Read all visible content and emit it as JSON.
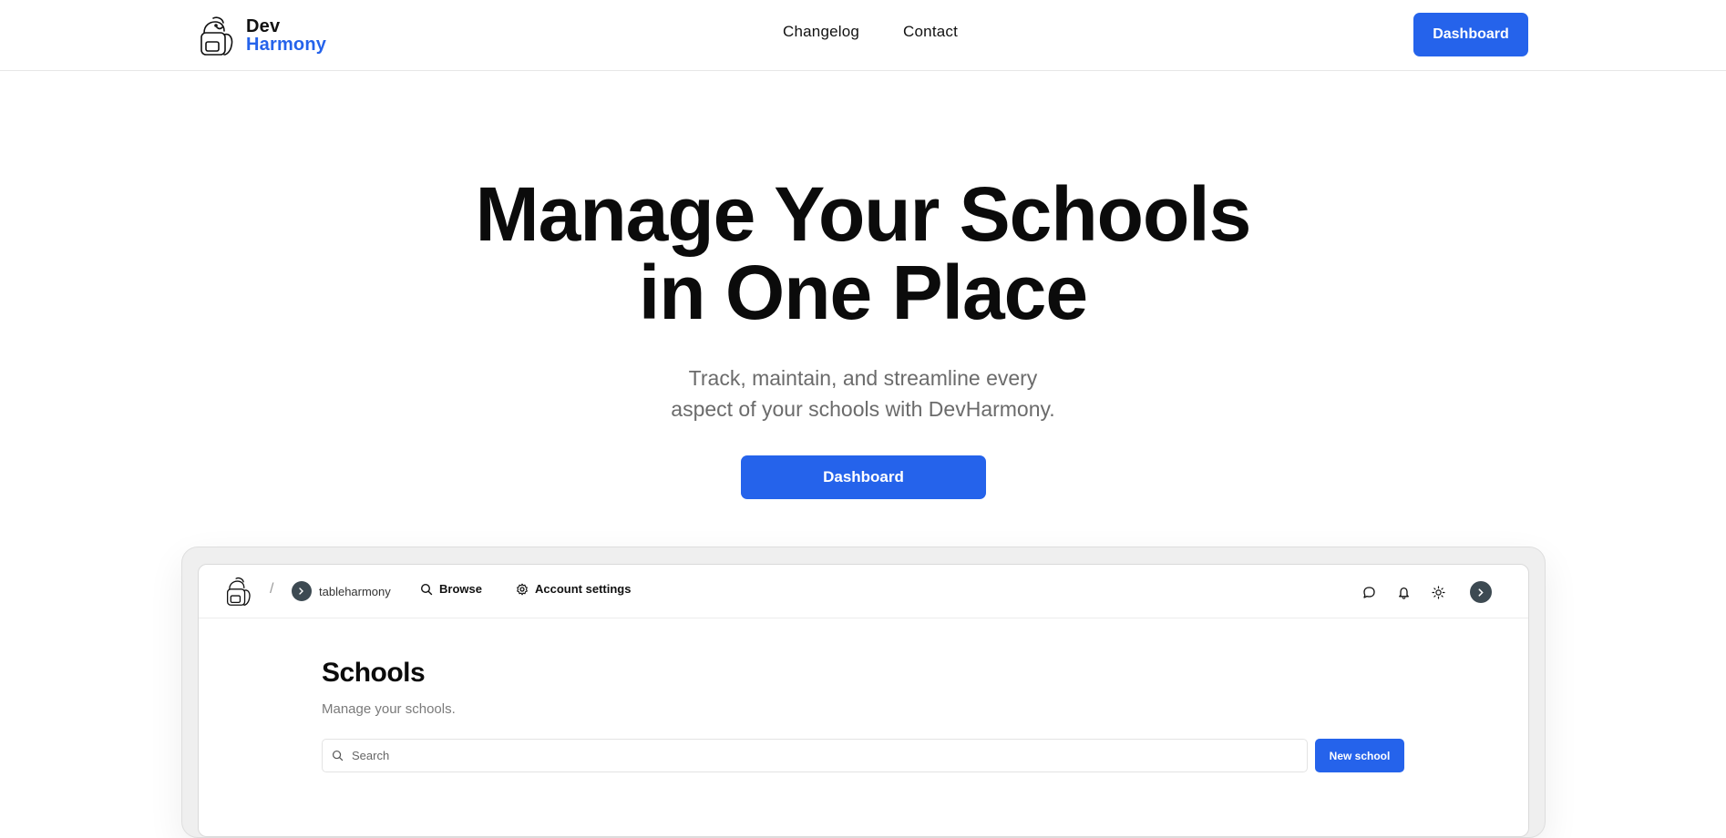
{
  "header": {
    "brand_line1": "Dev",
    "brand_line2": "Harmony",
    "nav": [
      "Changelog",
      "Contact"
    ],
    "dashboard_label": "Dashboard"
  },
  "hero": {
    "title_line1": "Manage Your Schools",
    "title_line2": "in One Place",
    "subtitle_line1": "Track, maintain, and streamline every",
    "subtitle_line2": "aspect of your schools with DevHarmony.",
    "cta_label": "Dashboard"
  },
  "preview": {
    "breadcrumb_separator": "/",
    "org_name": "tableharmony",
    "browse_label": "Browse",
    "settings_label": "Account settings",
    "icons": [
      "chat-icon",
      "bell-icon",
      "sun-icon",
      "user-avatar"
    ],
    "page_title": "Schools",
    "page_subtitle": "Manage your schools.",
    "search_placeholder": "Search",
    "new_button_label": "New school"
  },
  "colors": {
    "accent": "#2563eb",
    "avatar": "#3d4a52",
    "text": "#0b0b0b",
    "muted": "#6b6b6b"
  }
}
